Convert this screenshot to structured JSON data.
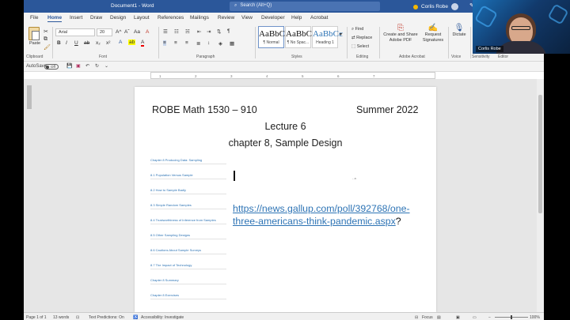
{
  "titlebar": {
    "doc_title": "Document1 - Word",
    "search_placeholder": "Search (Alt+Q)",
    "user_name": "Corlis Robe"
  },
  "menu": [
    "File",
    "Home",
    "Insert",
    "Draw",
    "Design",
    "Layout",
    "References",
    "Mailings",
    "Review",
    "View",
    "Developer",
    "Help",
    "Acrobat"
  ],
  "ribbon": {
    "paste_label": "Paste",
    "font_name": "Arial",
    "font_size": "20",
    "grow": "A^",
    "shrink": "Aˇ",
    "case": "Aa",
    "clear": "A",
    "bold": "B",
    "italic": "I",
    "underline": "U",
    "strike": "ab",
    "sub": "x₂",
    "sup": "x²",
    "styles": [
      {
        "sample": "AaBbC",
        "name": "¶ Normal"
      },
      {
        "sample": "AaBbC",
        "name": "¶ No Spac..."
      },
      {
        "sample": "AaBbCc",
        "name": "Heading 1"
      }
    ],
    "find": "Find",
    "replace": "Replace",
    "select": "Select",
    "create_share_1": "Create and Share",
    "create_share_2": "Adobe PDF",
    "request_1": "Request",
    "request_2": "Signatures",
    "dictate": "Dictate",
    "sensitivity": "Sensitivity",
    "editor": "Editor",
    "groups": {
      "clipboard": "Clipboard",
      "font": "Font",
      "paragraph": "Paragraph",
      "styles": "Styles",
      "editing": "Editing",
      "adobe": "Adobe Acrobat",
      "voice": "Voice",
      "sensitivity": "Sensitivity",
      "editor": "Editor"
    }
  },
  "qat": {
    "autosave": "AutoSave",
    "autosave_state": "Off"
  },
  "ruler_ticks": [
    "1",
    "2",
    "3",
    "4",
    "5",
    "6",
    "7"
  ],
  "page": {
    "course": "ROBE  Math 1530 – 910",
    "term": "Summer 2022",
    "lecture": "Lecture 6",
    "chapter": "chapter 8, Sample Design",
    "toc": [
      "Chapter 8 Producing Data: Sampling",
      "8.1 Population Versus Sample",
      "8.2 How to Sample Badly",
      "8.3 Simple Random Samples",
      "8.4 Trustworthiness of Inference from Samples",
      "8.5 Other Sampling Designs",
      "8.6 Cautions About Sample Surveys",
      "8.7 The Impact of Technology",
      "Chapter 8 Summary",
      "Chapter 8 Exercises"
    ],
    "stray_mark": "- a",
    "link_text": "https://news.gallup.com/poll/392768/one-three-americans-think-pandemic.aspx",
    "link_suffix": "?"
  },
  "status": {
    "page": "Page 1 of 1",
    "words": "13 words",
    "predictions": "Text Predictions: On",
    "accessibility": "Accessibility: Investigate",
    "focus": "Focus",
    "zoom": "100%"
  },
  "webcam": {
    "name": "Corlis Robe"
  },
  "colors": {
    "accent": "#2b579a",
    "link": "#2e74b5"
  }
}
